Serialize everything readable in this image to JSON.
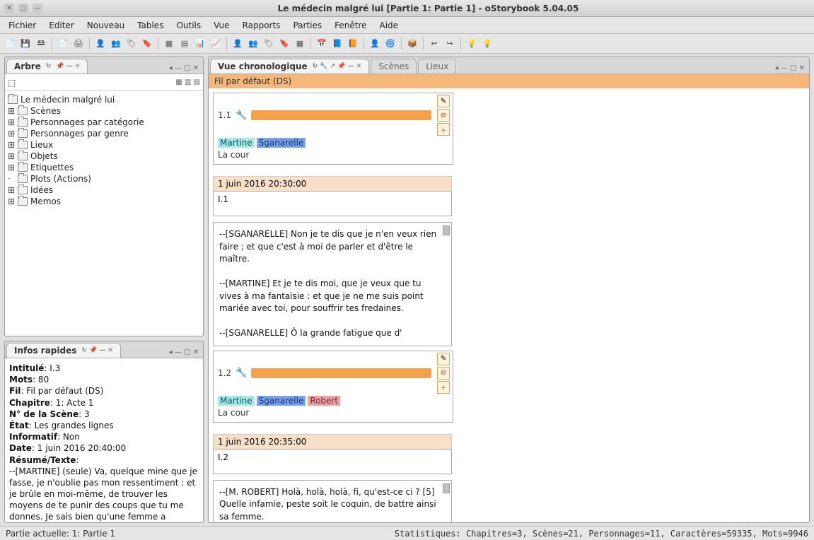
{
  "window": {
    "title": "Le médecin malgré lui [Partie 1: Partie 1] - oStorybook 5.04.05"
  },
  "menubar": [
    "Fichier",
    "Editer",
    "Nouveau",
    "Tables",
    "Outils",
    "Vue",
    "Rapports",
    "Parties",
    "Fenêtre",
    "Aide"
  ],
  "toolbar_icons": [
    "📄",
    "💾",
    "🖴",
    "",
    "📄",
    "🖨",
    "",
    "👤",
    "👥",
    "🏷",
    "🔖",
    "",
    "▦",
    "▤",
    "📊",
    "📈",
    "",
    "👤",
    "👥",
    "🏷",
    "🔖",
    "▦",
    "",
    "📅",
    "📘",
    "📙",
    "",
    "👤",
    "🌀",
    "",
    "📦",
    "",
    "↩",
    "↪",
    "",
    "💡",
    "💡"
  ],
  "arbre": {
    "tab_label": "Arbre",
    "root": "Le médecin malgré lui",
    "nodes": [
      "Scènes",
      "Personnages par catégorie",
      "Personnages par genre",
      "Lieux",
      "Objets",
      "Etiquettes",
      "Plots (Actions)",
      "Idées",
      "Memos"
    ]
  },
  "infos": {
    "tab_label": "Infos rapides",
    "lines": {
      "intitule_k": "Intitulé",
      "intitule_v": ": I.3",
      "mots_k": "Mots",
      "mots_v": ": 80",
      "fil_k": "Fil",
      "fil_v": ": Fil par défaut (DS)",
      "chapitre_k": "Chapitre",
      "chapitre_v": ": 1: Acte 1",
      "nscene_k": "N° de la Scène",
      "nscene_v": ": 3",
      "etat_k": "État",
      "etat_v": ": Les grandes lignes",
      "informatif_k": "Informatif",
      "informatif_v": ": Non",
      "date_k": "Date",
      "date_v": ": 1 juin 2016 20:40:00",
      "resume_k": "Résumé/Texte",
      "resume_v": ":"
    },
    "body": "--[MARTINE] (seule) Va, quelque mine que je fasse, je n'oublie pas mon ressentiment : et je brûle en moi-même, de trouver les moyens de te punir des coups que tu me donnes. Je sais bien qu'une femme a toujours"
  },
  "chrono": {
    "tab_label": "Vue chronologique",
    "tab_scenes": "Scènes",
    "tab_lieux": "Lieux",
    "thread": "Fil par défaut (DS)",
    "scene1": {
      "num": "1.1",
      "chars": {
        "martine": "Martine",
        "sgan": "Sganarelle"
      },
      "loc": "La cour",
      "date": "1 juin 2016 20:30:00",
      "title": "I.1",
      "text": "--[SGANARELLE] Non je te dis que je n'en veux rien faire ; et que c'est à moi de parler et d'être le maître.\n\n--[MARTINE] Et je te dis moi, que je veux que tu vives à ma fantaisie : et que je ne me suis point mariée avec toi, pour souffrir tes fredaines.\n\n--[SGANARELLE] Ô la grande fatigue que d'"
    },
    "scene2": {
      "num": "1.2",
      "chars": {
        "martine": "Martine",
        "sgan": "Sganarelle",
        "robert": "Robert"
      },
      "loc": "La cour",
      "date": "1 juin 2016 20:35:00",
      "title": "I.2",
      "text": "--[M. ROBERT] Holà, holà, holà, fi, qu'est-ce ci ? [5] Quelle infamie, peste soit le coquin, de battre ainsi sa femme."
    }
  },
  "statusbar": {
    "left": "Partie actuelle: 1: Partie 1",
    "right": "Statistiques: Chapitres=3, Scènes=21, Personnages=11, Caractères=59335, Mots=9946"
  }
}
